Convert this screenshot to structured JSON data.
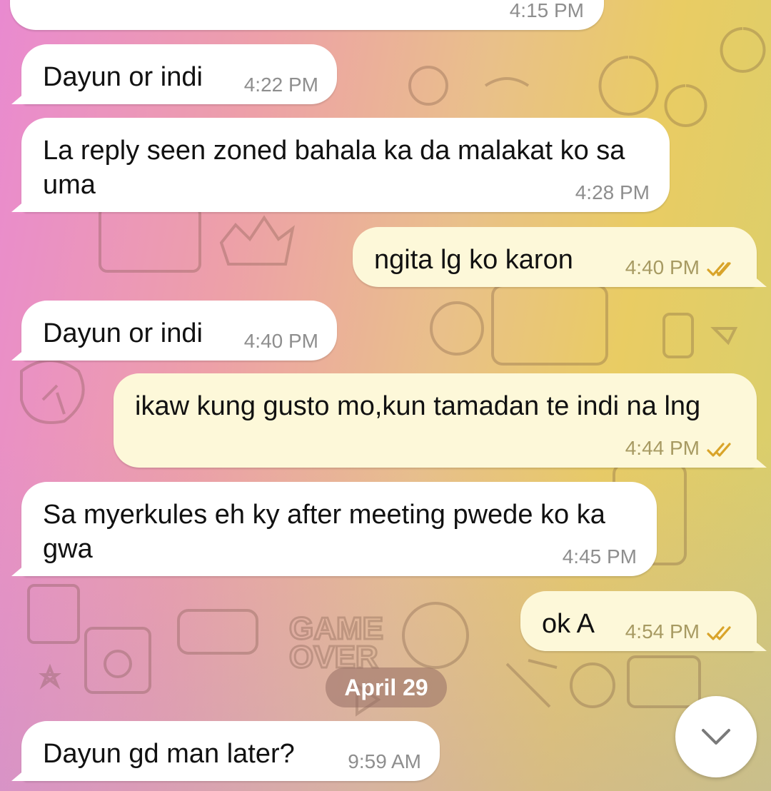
{
  "chat": {
    "messages": [
      {
        "text": "",
        "time": "4:15 PM",
        "dir": "in"
      },
      {
        "text": "Dayun or indi",
        "time": "4:22 PM",
        "dir": "in"
      },
      {
        "text": "La reply seen zoned bahala ka da malakat ko sa uma",
        "time": "4:28 PM",
        "dir": "in"
      },
      {
        "text": "ngita lg ko karon",
        "time": "4:40 PM",
        "dir": "out",
        "status": "read"
      },
      {
        "text": "Dayun or indi",
        "time": "4:40 PM",
        "dir": "in"
      },
      {
        "text": "ikaw kung gusto mo,kun tamadan te indi na lng",
        "time": "4:44 PM",
        "dir": "out",
        "status": "read"
      },
      {
        "text": "Sa myerkules eh ky after meeting pwede ko ka gwa",
        "time": "4:45 PM",
        "dir": "in"
      },
      {
        "text": "ok A",
        "time": "4:54 PM",
        "dir": "out",
        "status": "read"
      },
      {
        "text": "Dayun gd man later?",
        "time": "9:59 AM",
        "dir": "in"
      }
    ],
    "date_separator": "April 29",
    "scroll_button_icon": "chevron-down-icon",
    "read_receipt_icon": "double-check-icon"
  },
  "colors": {
    "incoming_bubble": "#ffffff",
    "outgoing_bubble": "#fdf8d9",
    "read_check": "#d9a42a",
    "date_pill": "#9a6e64"
  }
}
